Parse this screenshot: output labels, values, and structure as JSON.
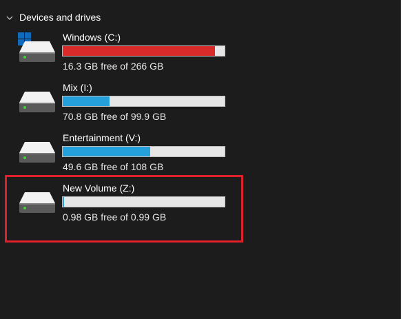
{
  "section": {
    "title": "Devices and drives"
  },
  "drives": [
    {
      "name": "Windows (C:)",
      "free_text": "16.3 GB free of 266 GB",
      "used_fraction": 0.939,
      "bar_color": "#da2b2b",
      "icon": "system-drive-icon"
    },
    {
      "name": "Mix (I:)",
      "free_text": "70.8 GB free of 99.9 GB",
      "used_fraction": 0.291,
      "bar_color": "#26a0da",
      "icon": "hard-drive-icon"
    },
    {
      "name": "Entertainment (V:)",
      "free_text": "49.6 GB free of 108 GB",
      "used_fraction": 0.541,
      "bar_color": "#26a0da",
      "icon": "hard-drive-icon"
    },
    {
      "name": "New Volume (Z:)",
      "free_text": "0.98 GB free of 0.99 GB",
      "used_fraction": 0.01,
      "bar_color": "#26a0da",
      "icon": "hard-drive-icon"
    }
  ],
  "highlight_color": "#e0202a"
}
